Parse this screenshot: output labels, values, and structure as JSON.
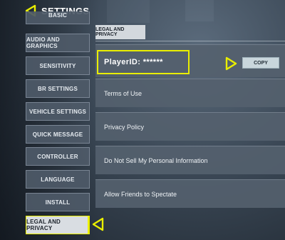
{
  "header": {
    "title": "SETTINGS"
  },
  "sidebar": {
    "items": [
      {
        "label": "BASIC"
      },
      {
        "label": "AUDIO AND GRAPHICS"
      },
      {
        "label": "SENSITIVITY"
      },
      {
        "label": "BR SETTINGS"
      },
      {
        "label": "VEHICLE SETTINGS"
      },
      {
        "label": "QUICK MESSAGE"
      },
      {
        "label": "CONTROLLER"
      },
      {
        "label": "LANGUAGE"
      },
      {
        "label": "INSTALL"
      },
      {
        "label": "LEGAL AND PRIVACY"
      }
    ],
    "active_index": 9
  },
  "tabs": [
    {
      "label": "LEGAL AND PRIVACY"
    }
  ],
  "player": {
    "id_text": "PlayerID: ******",
    "copy_label": "COPY"
  },
  "rows": [
    {
      "label": "Terms of Use"
    },
    {
      "label": "Privacy Policy"
    },
    {
      "label": "Do Not Sell My Personal Information"
    },
    {
      "label": "Allow Friends to Spectate"
    }
  ],
  "colors": {
    "highlight": "#e9ee00",
    "active_item_bg": "#d9dde2",
    "panel_row_bg": "#54606e"
  },
  "icons": {
    "back": "back-arrow-icon",
    "pointer": "pointer-arrow-icon"
  }
}
